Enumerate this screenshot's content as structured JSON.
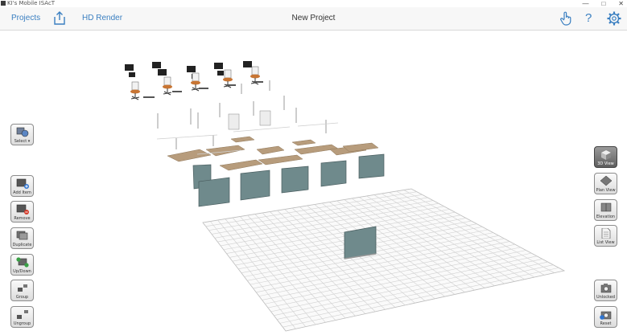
{
  "window": {
    "title": "KI's Mobile ISAcT",
    "minimize": "—",
    "maximize": "□",
    "close": "✕"
  },
  "toolbar": {
    "projects": "Projects",
    "hd_render": "HD Render",
    "project_title": "New Project",
    "icons": {
      "share": "share-icon",
      "touch": "hand-pointer-icon",
      "help": "help-icon",
      "settings": "gear-icon"
    },
    "help_glyph": "?",
    "accent": "#3a7fc1"
  },
  "left_tools": [
    {
      "name": "select",
      "label": "Select ▾"
    },
    {
      "name": "add-item",
      "label": "Add Item"
    },
    {
      "name": "remove",
      "label": "Remove"
    },
    {
      "name": "duplicate",
      "label": "Duplicate"
    },
    {
      "name": "up-down",
      "label": "Up/Down"
    },
    {
      "name": "group",
      "label": "Group"
    },
    {
      "name": "ungroup",
      "label": "Ungroup"
    }
  ],
  "right_tools": [
    {
      "name": "3d-view",
      "label": "3D View",
      "active": true
    },
    {
      "name": "plan-view",
      "label": "Plan View",
      "active": false
    },
    {
      "name": "elevation",
      "label": "Elevation",
      "active": false
    },
    {
      "name": "list-view",
      "label": "List View",
      "active": false
    },
    {
      "name": "unlocked",
      "label": "Unlocked",
      "active": false
    },
    {
      "name": "reset",
      "label": "Reset",
      "active": false
    }
  ],
  "colors": {
    "panel": "#6f8a8c",
    "desk": "#b79c7c",
    "chair_seat": "#c87533",
    "grid": "#d0d0d0"
  }
}
